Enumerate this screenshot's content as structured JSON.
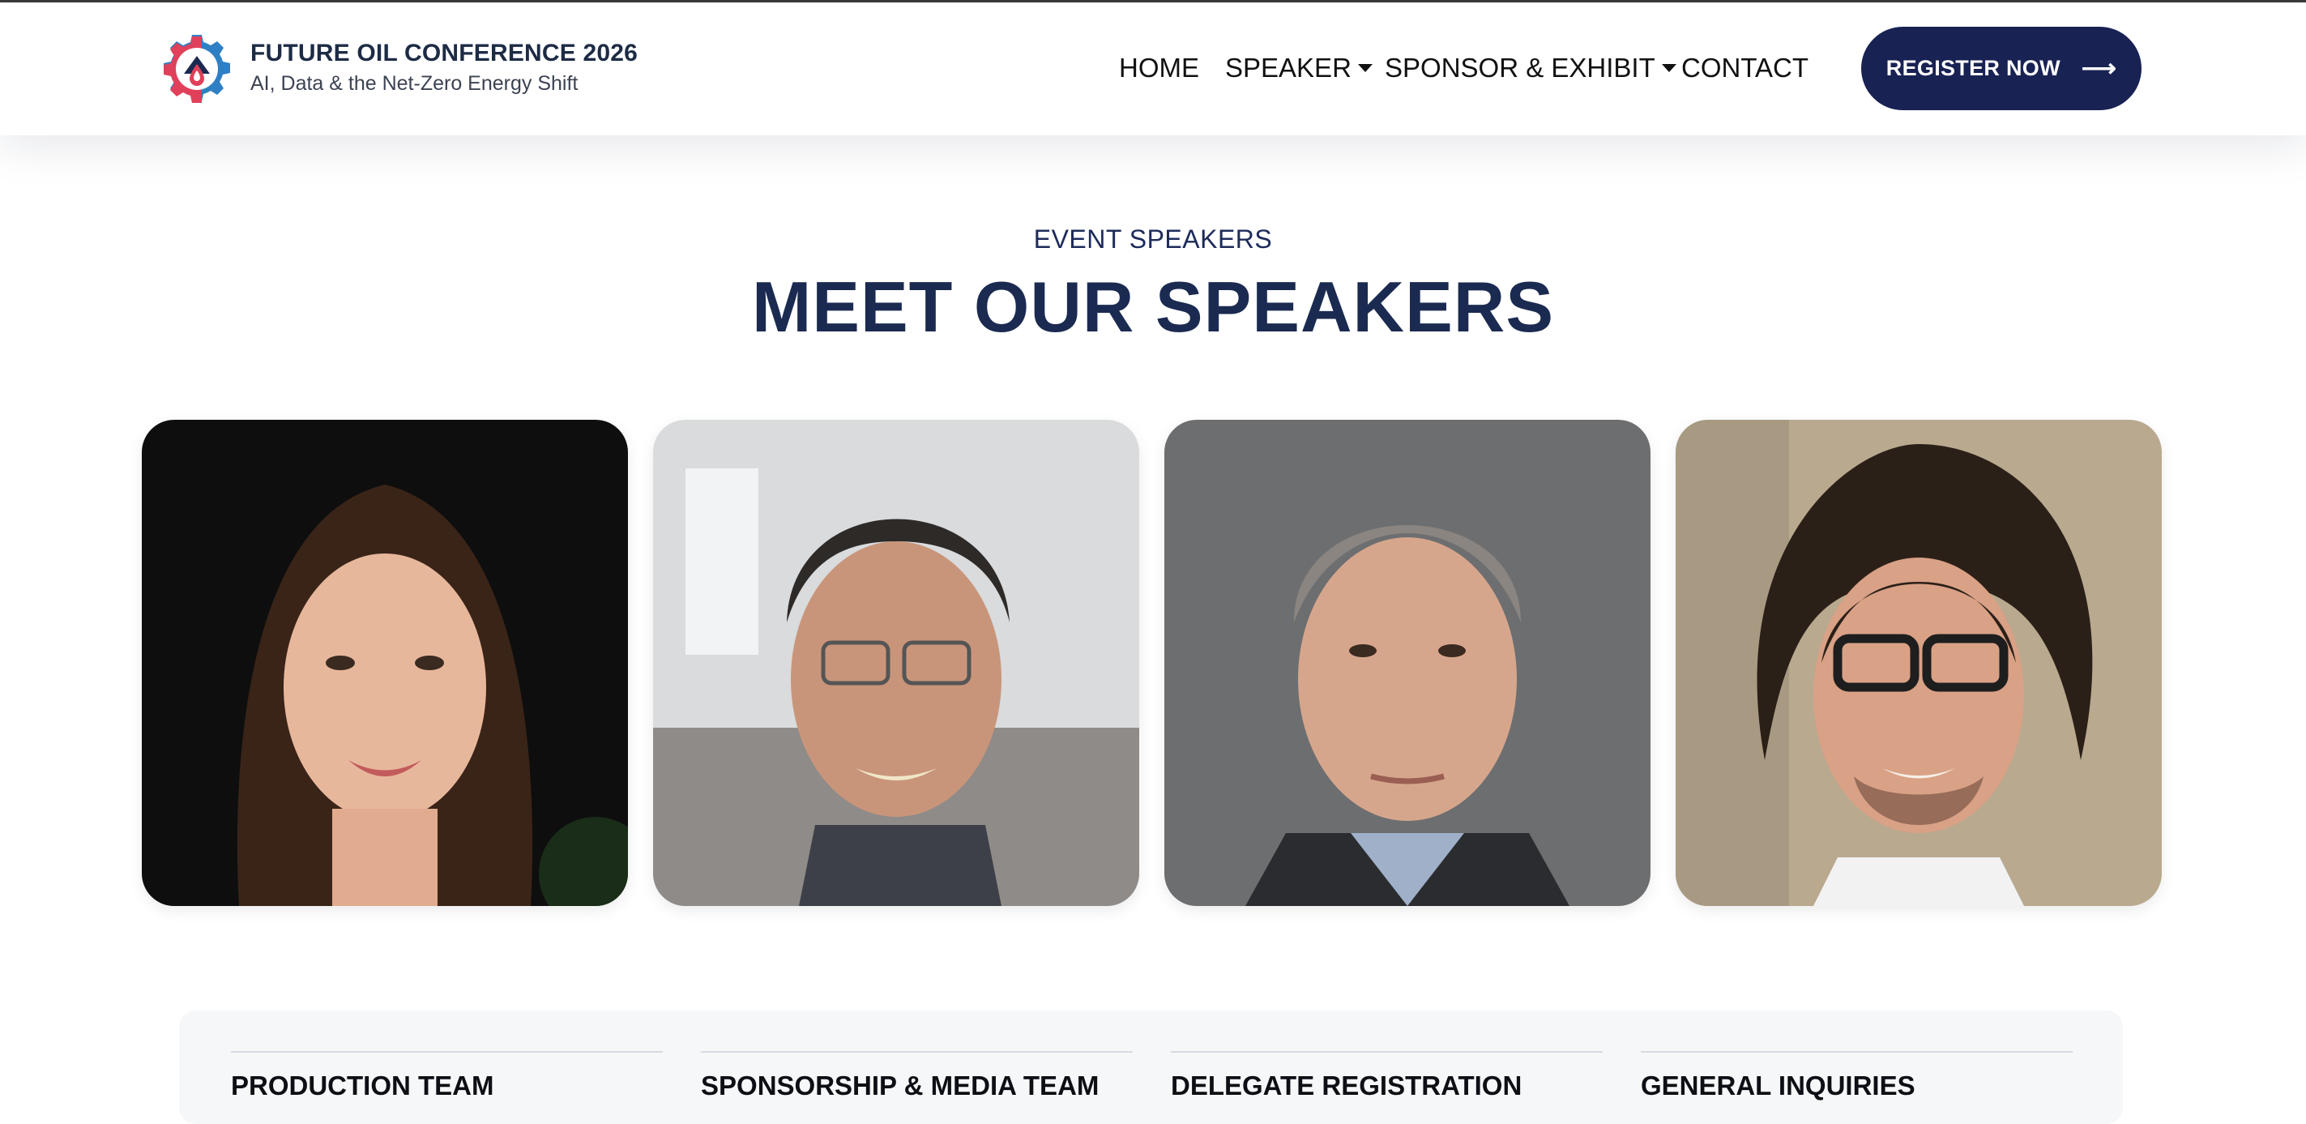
{
  "brand": {
    "title": "FUTURE OIL CONFERENCE 2026",
    "subtitle": "AI, Data & the Net-Zero Energy Shift",
    "logo_icon": "gear-droplet-logo-icon"
  },
  "nav": {
    "items": [
      {
        "label": "HOME",
        "has_dropdown": false
      },
      {
        "label": "SPEAKER",
        "has_dropdown": true
      },
      {
        "label": "SPONSOR & EXHIBIT",
        "has_dropdown": true
      },
      {
        "label": "CONTACT",
        "has_dropdown": false
      }
    ],
    "cta_label": "REGISTER NOW",
    "cta_icon": "arrow-right-icon"
  },
  "speakers_section": {
    "eyebrow": "EVENT SPEAKERS",
    "title": "MEET OUR SPEAKERS"
  },
  "contact_section": {
    "columns": [
      "PRODUCTION TEAM",
      "SPONSORSHIP & MEDIA TEAM",
      "DELEGATE REGISTRATION",
      "GENERAL INQUIRIES"
    ]
  },
  "colors": {
    "navy": "#182253",
    "title": "#1b2a50",
    "logo_red": "#e0405a",
    "logo_blue": "#2f7fc4"
  }
}
